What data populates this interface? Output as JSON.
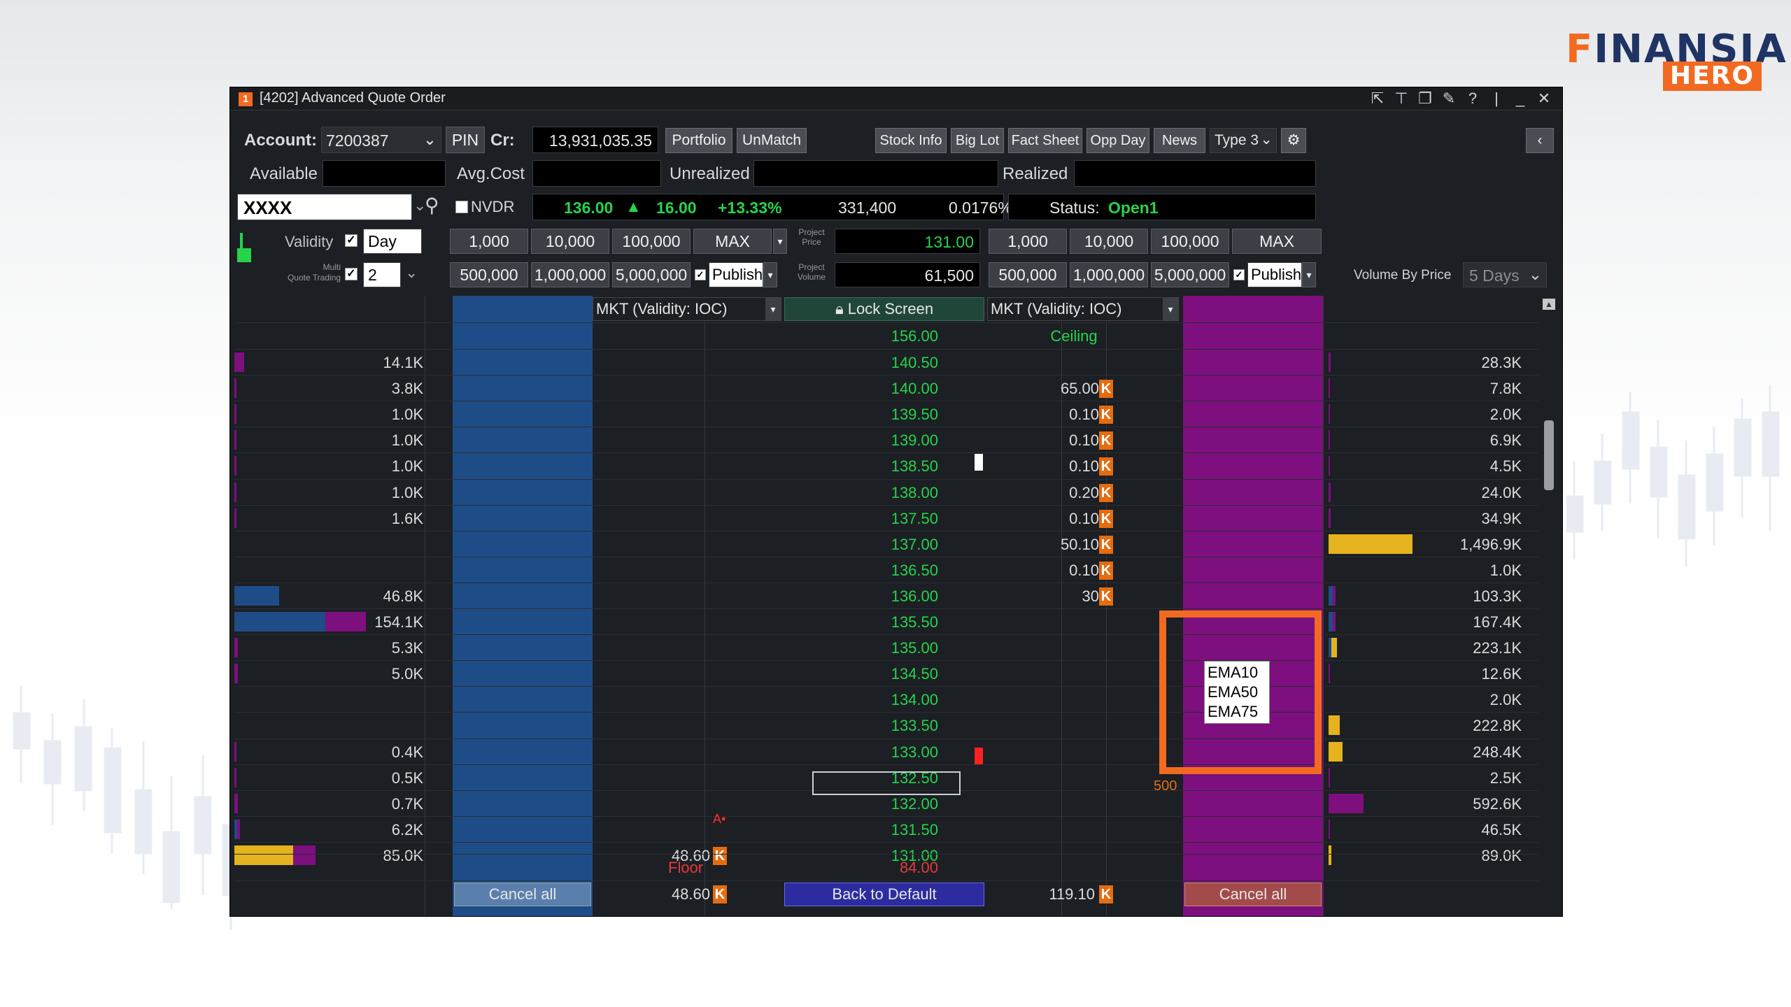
{
  "title": "[4202] Advanced Quote Order",
  "title_badge": "1",
  "logo": {
    "main": "INANSIA",
    "f": "F",
    "sub": "HERO"
  },
  "toolbar": {
    "account_label": "Account:",
    "account_value": "7200387",
    "pin": "PIN",
    "cr_label": "Cr:",
    "cr_value": "13,931,035.35",
    "portfolio": "Portfolio",
    "unmatch": "UnMatch",
    "stock_info": "Stock Info",
    "big_lot": "Big Lot",
    "fact_sheet": "Fact Sheet",
    "opp_day": "Opp Day",
    "news": "News",
    "type": "Type 3"
  },
  "summary": {
    "available": "Available",
    "avg_cost": "Avg.Cost",
    "unrealized": "Unrealized",
    "realized": "Realized"
  },
  "quote": {
    "symbol": "XXXX",
    "nvdr": "NVDR",
    "last": "136.00",
    "change": "16.00",
    "pct": "+13.33%",
    "volume": "331,400",
    "ratio": "0.0176%",
    "status_label": "Status:",
    "status_value": "Open1"
  },
  "order": {
    "validity_label": "Validity",
    "validity_value": "Day",
    "multi_label_1": "Multi",
    "multi_label_2": "Quote Trading",
    "multi_value": "2",
    "qty_row1": [
      "1,000",
      "10,000",
      "100,000",
      "MAX"
    ],
    "qty_row2": [
      "500,000",
      "1,000,000",
      "5,000,000"
    ],
    "publish": "Publish",
    "project_price_label_1": "Project",
    "project_price_label_2": "Price",
    "project_price": "131.00",
    "project_volume_label_1": "Project",
    "project_volume_label_2": "Volume",
    "project_volume": "61,500",
    "volume_by_price_label": "Volume By Price",
    "volume_by_price_value": "5 Days"
  },
  "ladder_header": {
    "bid_mkt": "MKT (Validity: IOC)",
    "lock": "Lock Screen",
    "ask_mkt": "MKT (Validity: IOC)",
    "ceiling_price": "156.00",
    "ceiling": "Ceiling"
  },
  "ladder": [
    {
      "lv": "14.1K",
      "price": "140.50",
      "aq": "",
      "rv": "28.3K"
    },
    {
      "lv": "3.8K",
      "price": "140.00",
      "aq": "65.00",
      "rv": "7.8K"
    },
    {
      "lv": "1.0K",
      "price": "139.50",
      "aq": "0.10",
      "rv": "2.0K"
    },
    {
      "lv": "1.0K",
      "price": "139.00",
      "aq": "0.10",
      "rv": "6.9K"
    },
    {
      "lv": "1.0K",
      "price": "138.50",
      "aq": "0.10",
      "rv": "4.5K"
    },
    {
      "lv": "1.0K",
      "price": "138.00",
      "aq": "0.20",
      "rv": "24.0K"
    },
    {
      "lv": "1.6K",
      "price": "137.50",
      "aq": "0.10",
      "rv": "34.9K"
    },
    {
      "lv": "",
      "price": "137.00",
      "aq": "50.10",
      "rv": "1,496.9K"
    },
    {
      "lv": "",
      "price": "136.50",
      "aq": "0.10",
      "rv": "1.0K"
    },
    {
      "lv": "46.8K",
      "price": "136.00",
      "aq": "30",
      "rv": "103.3K"
    },
    {
      "lv": "154.1K",
      "price": "135.50",
      "aq": "",
      "rv": "167.4K"
    },
    {
      "lv": "5.3K",
      "price": "135.00",
      "aq": "",
      "rv": "223.1K"
    },
    {
      "lv": "5.0K",
      "price": "134.50",
      "aq": "",
      "rv": "12.6K"
    },
    {
      "lv": "",
      "price": "134.00",
      "aq": "",
      "rv": "2.0K"
    },
    {
      "lv": "",
      "price": "133.50",
      "aq": "",
      "rv": "222.8K"
    },
    {
      "lv": "0.4K",
      "price": "133.00",
      "aq": "",
      "rv": "248.4K"
    },
    {
      "lv": "0.5K",
      "price": "132.50",
      "aq": "",
      "rv": "2.5K"
    },
    {
      "lv": "0.7K",
      "price": "132.00",
      "aq": "",
      "rv": "592.6K"
    },
    {
      "lv": "6.2K",
      "price": "131.50",
      "aq": "",
      "rv": "46.5K"
    },
    {
      "lv": "85.0K",
      "price": "131.00",
      "aq": "",
      "rv": "89.0K"
    }
  ],
  "k": "K",
  "extra": {
    "ask_500": "500",
    "bid_4860": "48.60",
    "a_marker": "A•"
  },
  "footer": {
    "floor": "Floor",
    "floor_price": "84.00",
    "cancel_all_bid": "Cancel all",
    "bid_total": "48.60",
    "back_default": "Back to Default",
    "ask_total": "119.10",
    "cancel_all_ask": "Cancel all"
  },
  "tooltip": [
    "EMA10",
    "EMA50",
    "EMA75"
  ],
  "colors": {
    "accent": "#f26a21",
    "up": "#27d34a",
    "bid": "#1e4c86",
    "ask": "#7e0f7e",
    "vol": "#e4b31e"
  }
}
